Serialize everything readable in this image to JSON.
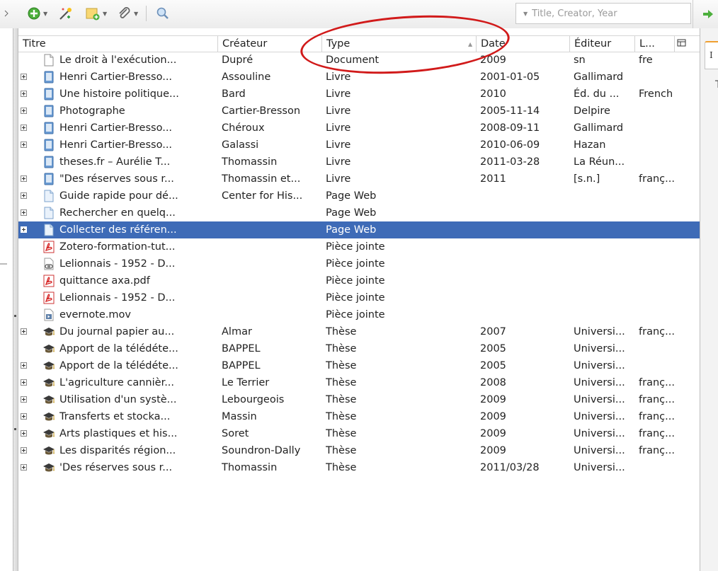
{
  "search": {
    "placeholder": "Title, Creator, Year"
  },
  "columns": {
    "title": "Titre",
    "creator": "Créateur",
    "type": "Type",
    "date": "Date",
    "publisher": "Éditeur",
    "language": "L..."
  },
  "right_panel": {
    "tab_letter": "I",
    "text": "T"
  },
  "rows": [
    {
      "title": "Le droit à l'exécution...",
      "creator": "Dupré",
      "type": "Document",
      "date": "2009",
      "publisher": "sn",
      "language": "fre",
      "icon": "document-icon",
      "twisty": false
    },
    {
      "title": "Henri Cartier-Bresso...",
      "creator": "Assouline",
      "type": "Livre",
      "date": "2001-01-05",
      "publisher": "Gallimard",
      "language": "",
      "icon": "book-icon",
      "twisty": true
    },
    {
      "title": "Une histoire politique...",
      "creator": "Bard",
      "type": "Livre",
      "date": "2010",
      "publisher": "Éd. du ...",
      "language": "French",
      "icon": "book-icon",
      "twisty": true
    },
    {
      "title": "Photographe",
      "creator": "Cartier-Bresson",
      "type": "Livre",
      "date": "2005-11-14",
      "publisher": "Delpire",
      "language": "",
      "icon": "book-icon",
      "twisty": true
    },
    {
      "title": "Henri Cartier-Bresso...",
      "creator": "Chéroux",
      "type": "Livre",
      "date": "2008-09-11",
      "publisher": "Gallimard",
      "language": "",
      "icon": "book-icon",
      "twisty": true
    },
    {
      "title": "Henri Cartier-Bresso...",
      "creator": "Galassi",
      "type": "Livre",
      "date": "2010-06-09",
      "publisher": "Hazan",
      "language": "",
      "icon": "book-icon",
      "twisty": true
    },
    {
      "title": "theses.fr – Aurélie T...",
      "creator": "Thomassin",
      "type": "Livre",
      "date": "2011-03-28",
      "publisher": "La Réun...",
      "language": "",
      "icon": "book-icon",
      "twisty": false
    },
    {
      "title": "\"Des réserves sous r...",
      "creator": "Thomassin et...",
      "type": "Livre",
      "date": "2011",
      "publisher": "[s.n.]",
      "language": "franç...",
      "icon": "book-icon",
      "twisty": true
    },
    {
      "title": "Guide rapide pour dé...",
      "creator": "Center for His...",
      "type": "Page Web",
      "date": "",
      "publisher": "",
      "language": "",
      "icon": "webpage-icon",
      "twisty": true
    },
    {
      "title": "Rechercher en quelq...",
      "creator": "",
      "type": "Page Web",
      "date": "",
      "publisher": "",
      "language": "",
      "icon": "webpage-icon",
      "twisty": true
    },
    {
      "title": "Collecter des référen...",
      "creator": "",
      "type": "Page Web",
      "date": "",
      "publisher": "",
      "language": "",
      "icon": "webpage-icon",
      "twisty": true,
      "selected": true
    },
    {
      "title": "Zotero-formation-tut...",
      "creator": "",
      "type": "Pièce jointe",
      "date": "",
      "publisher": "",
      "language": "",
      "icon": "pdf-icon",
      "twisty": false
    },
    {
      "title": "Lelionnais - 1952 - D...",
      "creator": "",
      "type": "Pièce jointe",
      "date": "",
      "publisher": "",
      "language": "",
      "icon": "link-attachment-icon",
      "twisty": false
    },
    {
      "title": "quittance axa.pdf",
      "creator": "",
      "type": "Pièce jointe",
      "date": "",
      "publisher": "",
      "language": "",
      "icon": "pdf-icon",
      "twisty": false
    },
    {
      "title": "Lelionnais - 1952 - D...",
      "creator": "",
      "type": "Pièce jointe",
      "date": "",
      "publisher": "",
      "language": "",
      "icon": "pdf-icon",
      "twisty": false
    },
    {
      "title": "evernote.mov",
      "creator": "",
      "type": "Pièce jointe",
      "date": "",
      "publisher": "",
      "language": "",
      "icon": "video-file-icon",
      "twisty": false
    },
    {
      "title": "Du journal papier au...",
      "creator": "Almar",
      "type": "Thèse",
      "date": "2007",
      "publisher": "Universi...",
      "language": "franç...",
      "icon": "thesis-icon",
      "twisty": true
    },
    {
      "title": "Apport de la télédéte...",
      "creator": "BAPPEL",
      "type": "Thèse",
      "date": "2005",
      "publisher": "Universi...",
      "language": "",
      "icon": "thesis-icon",
      "twisty": false
    },
    {
      "title": "Apport de la télédéte...",
      "creator": "BAPPEL",
      "type": "Thèse",
      "date": "2005",
      "publisher": "Universi...",
      "language": "",
      "icon": "thesis-icon",
      "twisty": true
    },
    {
      "title": "L'agriculture cannièr...",
      "creator": "Le Terrier",
      "type": "Thèse",
      "date": "2008",
      "publisher": "Universi...",
      "language": "franç...",
      "icon": "thesis-icon",
      "twisty": true
    },
    {
      "title": "Utilisation d'un systè...",
      "creator": "Lebourgeois",
      "type": "Thèse",
      "date": "2009",
      "publisher": "Universi...",
      "language": "franç...",
      "icon": "thesis-icon",
      "twisty": true
    },
    {
      "title": "Transferts et stocka...",
      "creator": "Massin",
      "type": "Thèse",
      "date": "2009",
      "publisher": "Universi...",
      "language": "franç...",
      "icon": "thesis-icon",
      "twisty": true
    },
    {
      "title": "Arts plastiques et his...",
      "creator": "Soret",
      "type": "Thèse",
      "date": "2009",
      "publisher": "Universi...",
      "language": "franç...",
      "icon": "thesis-icon",
      "twisty": true
    },
    {
      "title": "Les disparités région...",
      "creator": "Soundron-Dally",
      "type": "Thèse",
      "date": "2009",
      "publisher": "Universi...",
      "language": "franç...",
      "icon": "thesis-icon",
      "twisty": true
    },
    {
      "title": "'Des réserves sous r...",
      "creator": "Thomassin",
      "type": "Thèse",
      "date": "2011/03/28",
      "publisher": "Universi...",
      "language": "",
      "icon": "thesis-icon",
      "twisty": true
    }
  ]
}
